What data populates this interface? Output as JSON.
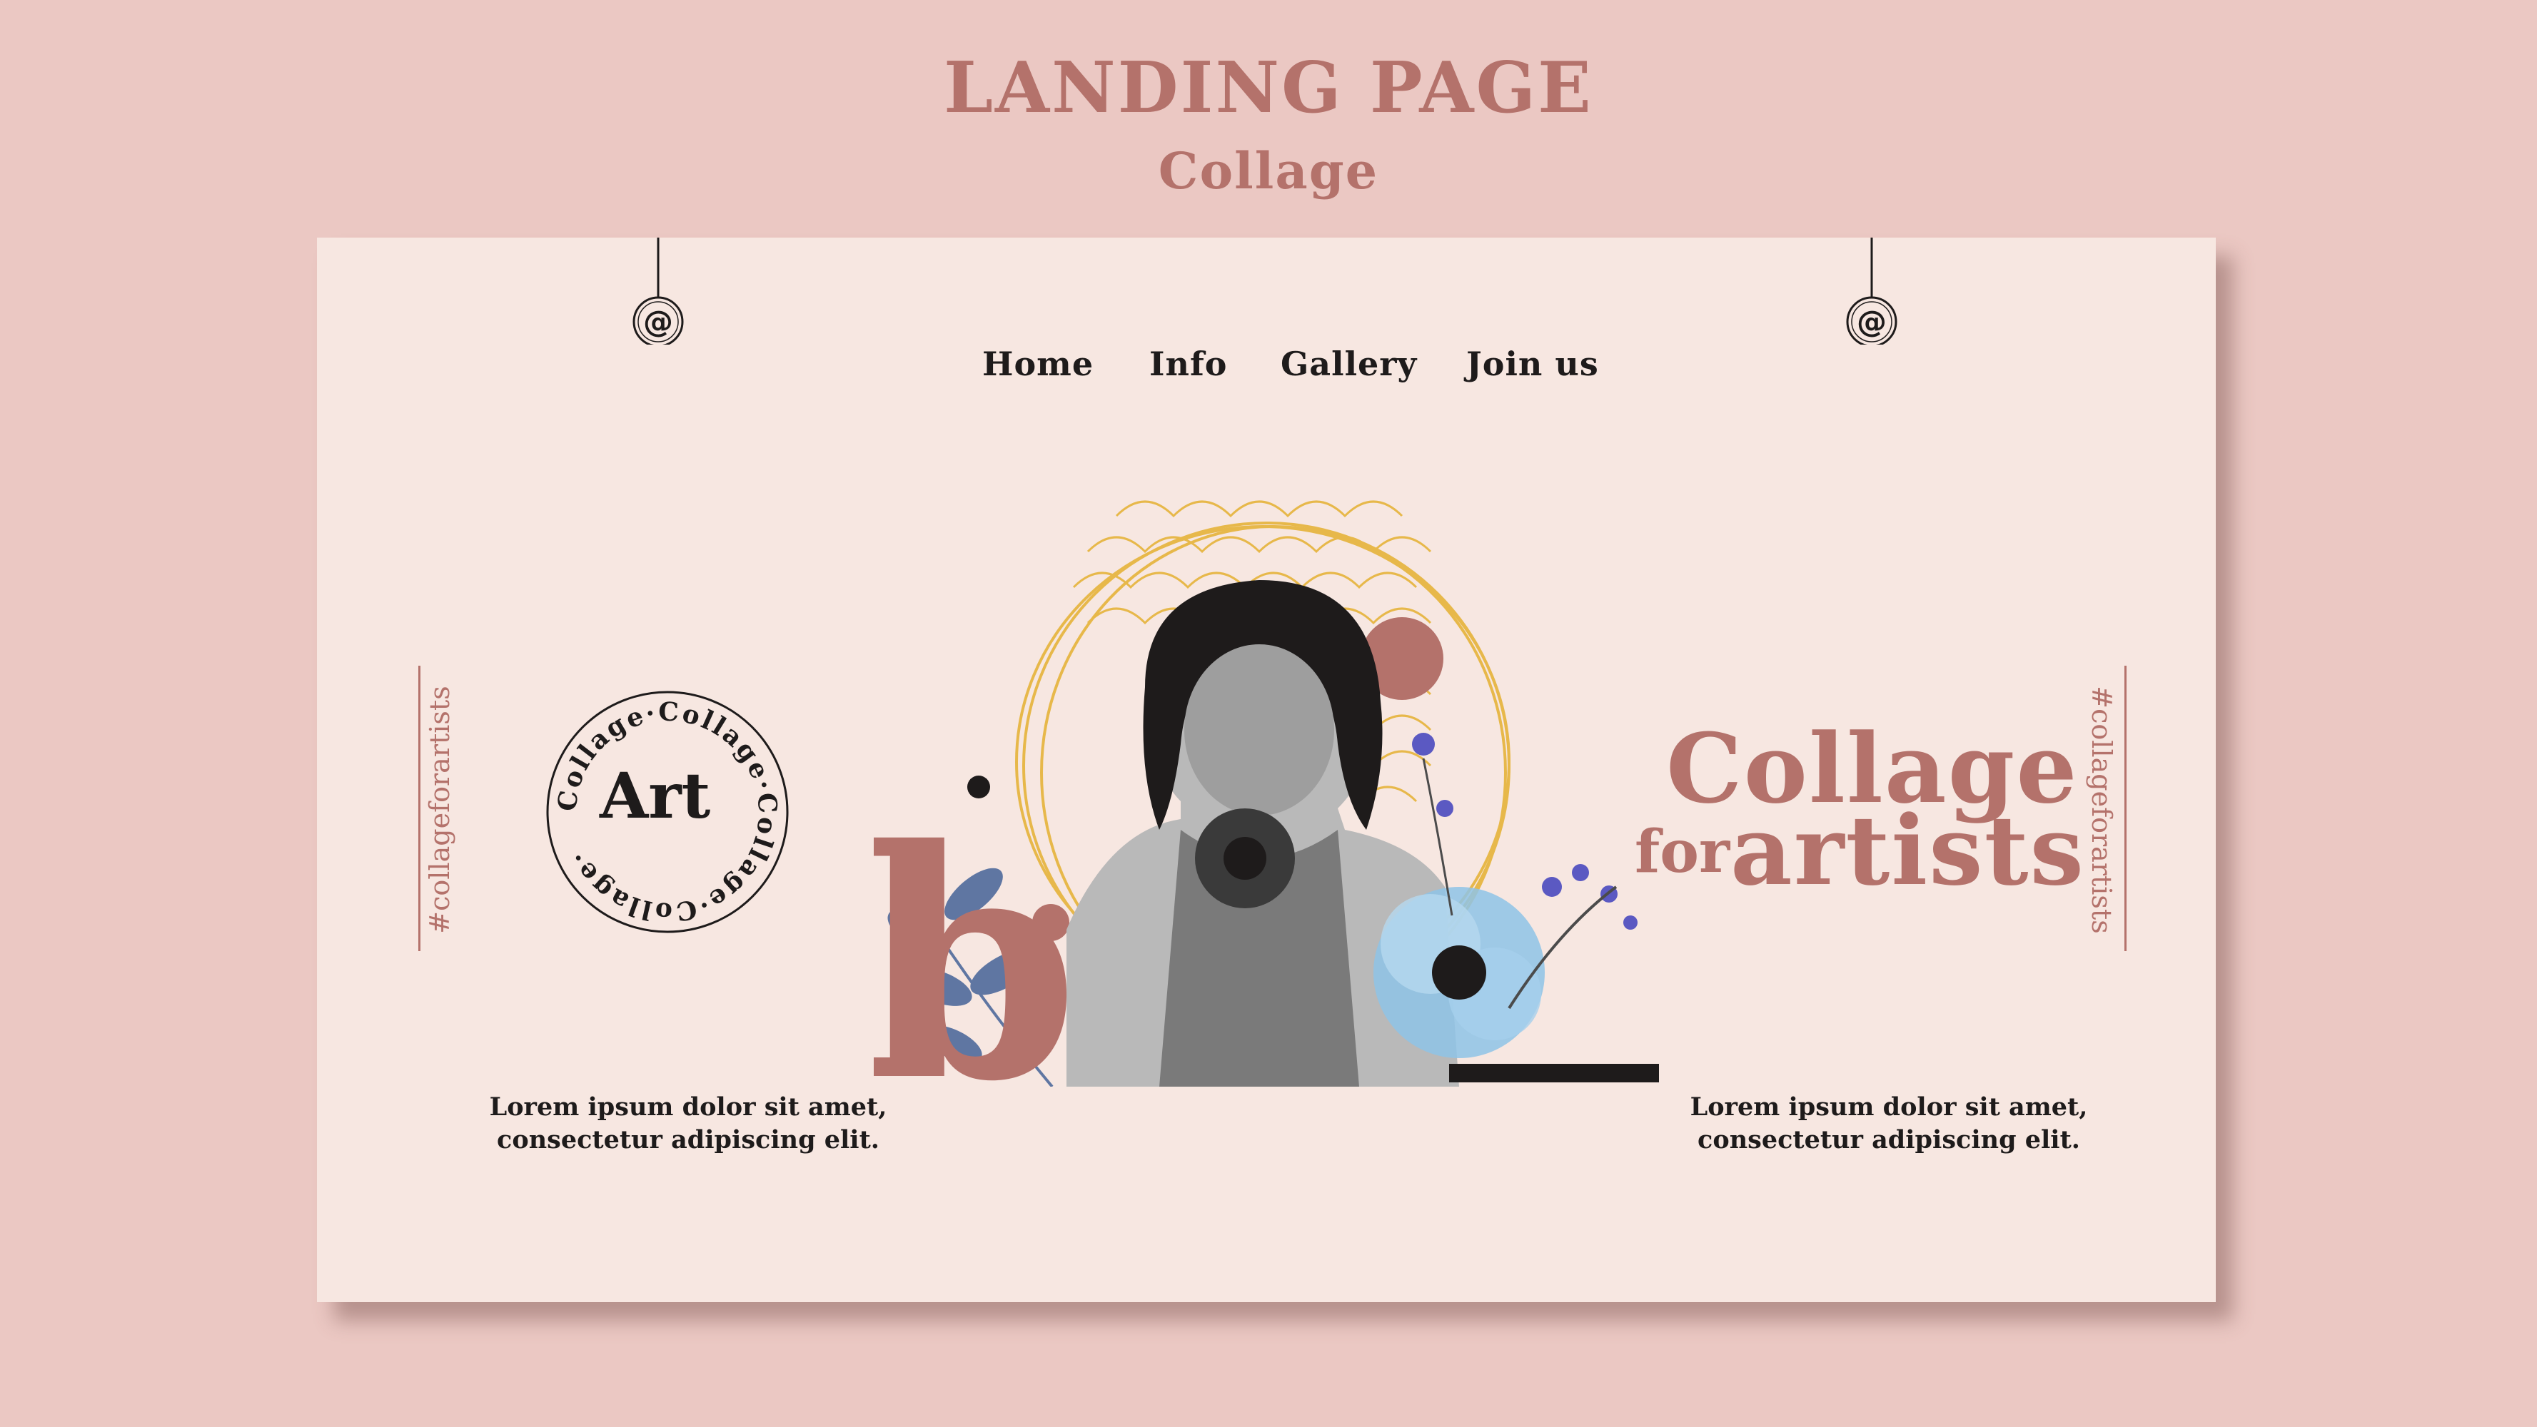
{
  "header": {
    "title": "LANDING PAGE",
    "subtitle": "Collage"
  },
  "nav": {
    "items": [
      "Home",
      "Info",
      "Gallery",
      "Join us"
    ]
  },
  "hangers": {
    "symbol": "@"
  },
  "side_tags": {
    "left": "#collageforartists",
    "right": "#collageforartists"
  },
  "badge": {
    "center": "Art",
    "ring_text": "Collage·Collage·Collage·Collage·"
  },
  "hero": {
    "title_line1": "Collage",
    "title_for": "for",
    "title_line2": "artists",
    "letter": "b"
  },
  "captions": {
    "left_line1": "Lorem ipsum dolor sit amet,",
    "left_line2": "consectetur adipiscing elit.",
    "right_line1": "Lorem ipsum dolor sit amet,",
    "right_line2": "consectetur adipiscing elit."
  },
  "colors": {
    "background": "#ebc8c3",
    "card": "#f7e7e1",
    "accent": "#b4726b",
    "text": "#1e1b1b",
    "gold": "#e7b84a",
    "flower_blue": "#8ec3e6",
    "leaf_blue": "#4f6a9c"
  },
  "icons": [
    "at-sign-icon",
    "photo-woman-with-flower",
    "watercolor-leaves",
    "watercolor-flower"
  ]
}
